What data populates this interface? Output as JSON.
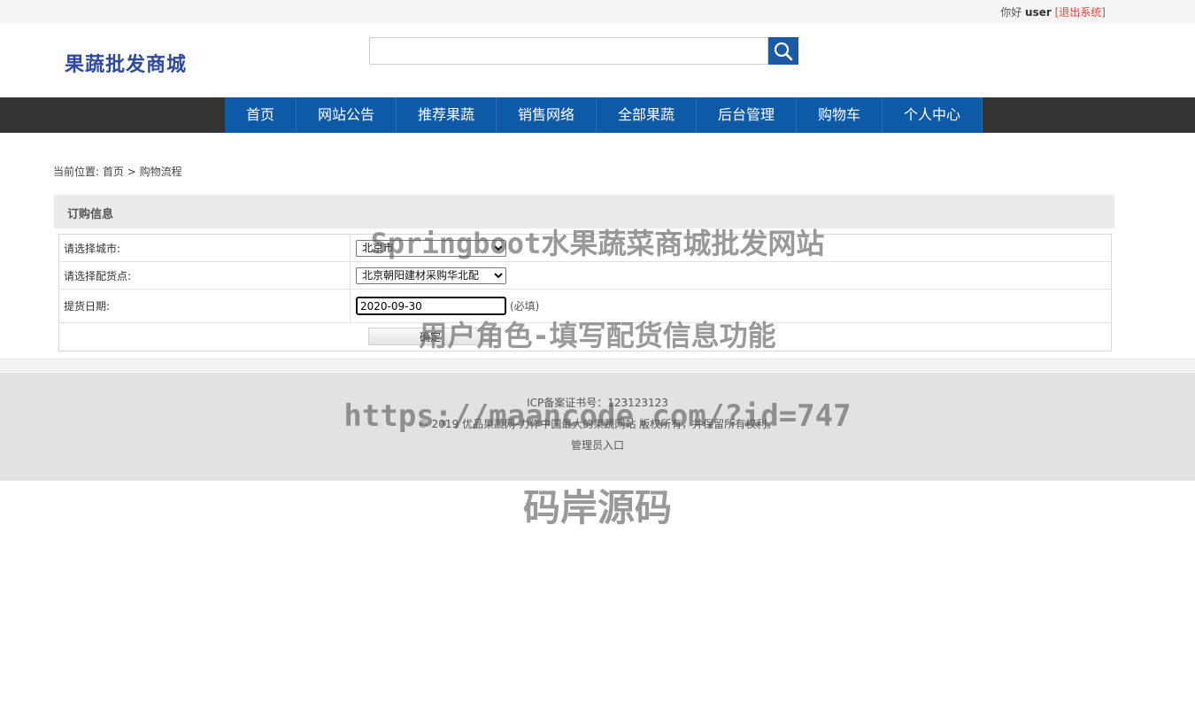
{
  "topbar": {
    "greeting": "你好",
    "username": "user",
    "logout": "[退出系统]"
  },
  "header": {
    "logo": "果蔬批发商城",
    "search_placeholder": "",
    "search_icon": "search-icon"
  },
  "nav": {
    "items": [
      {
        "label": "首页"
      },
      {
        "label": "网站公告"
      },
      {
        "label": "推荐果蔬"
      },
      {
        "label": "销售网络"
      },
      {
        "label": "全部果蔬"
      },
      {
        "label": "后台管理"
      },
      {
        "label": "购物车"
      },
      {
        "label": "个人中心"
      }
    ]
  },
  "breadcrumb": {
    "prefix": "当前位置:",
    "home": "首页",
    "separator": ">",
    "current": "购物流程"
  },
  "order": {
    "section_title": "订购信息",
    "city_label": "请选择城市:",
    "city_value": "北京市",
    "point_label": "请选择配货点:",
    "point_value": "北京朝阳建材采购华北配",
    "date_label": "提货日期:",
    "date_value": "2020-09-30",
    "required_note": "(必填)",
    "confirm_label": "确定"
  },
  "footer": {
    "icp": "ICP备案证书号：123123123",
    "copyright": "© 2019 优品果蔬网-力作中国最大的果蔬网站 版权所有，并保留所有权利。",
    "admin_link": "管理员入口"
  },
  "watermark": {
    "line1": "Springboot水果蔬菜商城批发网站",
    "line2": "用户角色-填写配货信息功能",
    "line3": "https://maancode.com/?id=747",
    "line4": "码岸源码"
  },
  "colors": {
    "brand_blue": "#0f5aa6",
    "nav_dark": "#333333",
    "logo_blue": "#2d4a9e",
    "logout_red": "#e0463b"
  }
}
